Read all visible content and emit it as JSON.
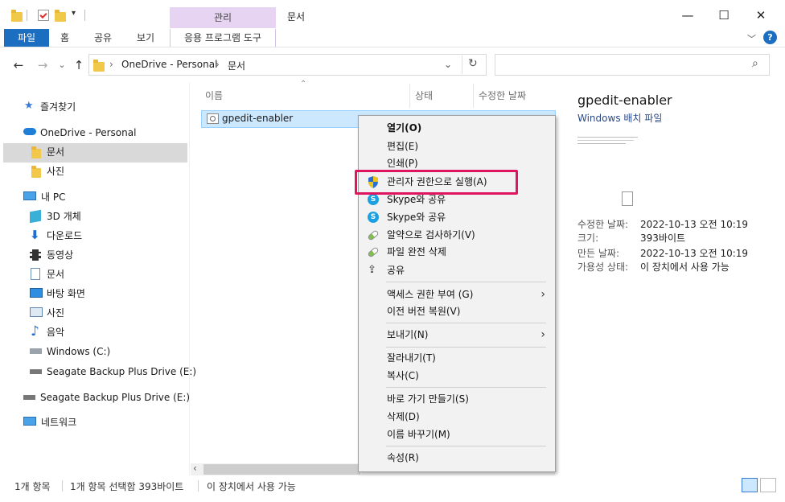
{
  "window": {
    "title": "문서",
    "context_tab_header": "관리",
    "minimize_glyph": "—",
    "maximize_glyph": "☐",
    "close_glyph": "✕"
  },
  "ribbon": {
    "tabs": [
      "파일",
      "홈",
      "공유",
      "보기",
      "응용 프로그램 도구"
    ],
    "expand_glyph": "﹀",
    "help_glyph": "?"
  },
  "nav": {
    "back": "←",
    "forward": "→",
    "recent": "⌄",
    "up": "↑",
    "breadcrumb": [
      "OneDrive - Personal",
      "문서"
    ],
    "separator": "›",
    "dropdown": "⌄",
    "refresh": "↻",
    "search_placeholder": "",
    "search_icon": "⌕"
  },
  "sidebar": {
    "items": [
      {
        "label": "즐겨찾기",
        "icon": "star-icon"
      },
      {
        "label": "OneDrive - Personal",
        "icon": "cloud-icon"
      },
      {
        "label": "문서",
        "icon": "folder-icon",
        "selected": true
      },
      {
        "label": "사진",
        "icon": "folder-icon"
      },
      {
        "label": "내 PC",
        "icon": "computer-icon"
      },
      {
        "label": "3D 개체",
        "icon": "cube-icon"
      },
      {
        "label": "다운로드",
        "icon": "download-icon"
      },
      {
        "label": "동영상",
        "icon": "film-icon"
      },
      {
        "label": "문서",
        "icon": "document-icon"
      },
      {
        "label": "바탕 화면",
        "icon": "desktop-icon"
      },
      {
        "label": "사진",
        "icon": "picture-icon"
      },
      {
        "label": "음악",
        "icon": "music-icon"
      },
      {
        "label": "Windows (C:)",
        "icon": "drive-icon"
      },
      {
        "label": "Seagate Backup Plus Drive (E:)",
        "icon": "usb-drive-icon"
      },
      {
        "label": "Seagate Backup Plus Drive (E:)",
        "icon": "usb-drive-icon"
      },
      {
        "label": "네트워크",
        "icon": "network-icon"
      }
    ]
  },
  "file_list": {
    "columns": [
      "이름",
      "상태",
      "수정한 날짜"
    ],
    "sort_glyph": "⌃",
    "files": [
      {
        "name": "gpedit-enabler",
        "icon": "batch-file-icon"
      }
    ]
  },
  "preview": {
    "title": "gpedit-enabler",
    "type": "Windows 배치 파일",
    "details": [
      {
        "key": "수정한 날짜:",
        "value": "2022-10-13 오전 10:19"
      },
      {
        "key": "크기:",
        "value": "393바이트"
      },
      {
        "key": "만든 날짜:",
        "value": "2022-10-13 오전 10:19"
      },
      {
        "key": "가용성 상태:",
        "value": "이 장치에서 사용 가능"
      }
    ]
  },
  "context_menu": {
    "items": [
      {
        "label": "열기(O)",
        "bold": true,
        "icon": ""
      },
      {
        "label": "편집(E)",
        "icon": ""
      },
      {
        "label": "인쇄(P)",
        "icon": ""
      },
      {
        "label": "관리자 권한으로 실행(A)",
        "icon": "uac-shield-icon",
        "highlighted": true
      },
      {
        "label": "Skype와 공유",
        "icon": "skype-icon"
      },
      {
        "label": "Skype와 공유",
        "icon": "skype-icon"
      },
      {
        "label": "알약으로 검사하기(V)",
        "icon": "alyac-icon"
      },
      {
        "label": "파일 완전 삭제",
        "icon": "alyac-icon"
      },
      {
        "label": "공유",
        "icon": "share-icon"
      },
      {
        "label": "액세스 권한 부여 (G)",
        "submenu": true
      },
      {
        "label": "이전 버전 복원(V)"
      },
      {
        "label": "보내기(N)",
        "submenu": true
      },
      {
        "label": "잘라내기(T)"
      },
      {
        "label": "복사(C)"
      },
      {
        "label": "바로 가기 만들기(S)"
      },
      {
        "label": "삭제(D)"
      },
      {
        "label": "이름 바꾸기(M)"
      },
      {
        "label": "속성(R)"
      }
    ],
    "submenu_glyph": "›"
  },
  "hscroll": {
    "left_glyph": "‹"
  },
  "status_bar": {
    "items": [
      "1개 항목",
      "1개 항목 선택함 393바이트",
      "이 장치에서 사용 가능"
    ]
  },
  "colors": {
    "accent": "#1c6ec1",
    "context_tab": "#e7d4f3",
    "selection": "#cce8ff",
    "highlight_box": "#e0155f"
  }
}
